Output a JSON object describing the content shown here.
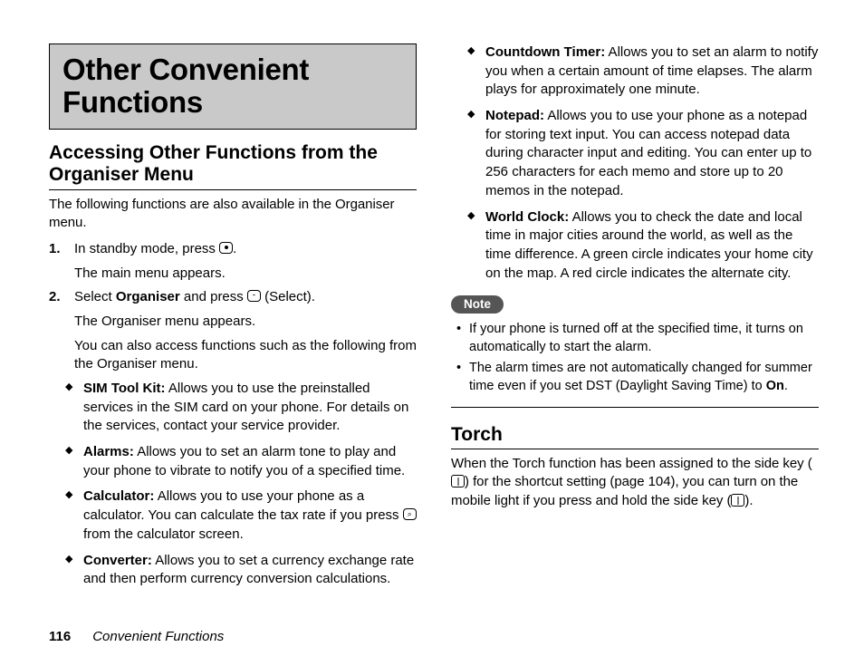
{
  "page_number": "116",
  "footer_title": "Convenient Functions",
  "chapter_title_line1": "Other Convenient",
  "chapter_title_line2": "Functions",
  "section1_title": "Accessing Other Functions from the Organiser Menu",
  "section1_intro": "The following functions are also available in the Organiser menu.",
  "steps": [
    {
      "num": "1.",
      "before": "In standby mode, press ",
      "after_key": ".",
      "result": "The main menu appears."
    },
    {
      "num": "2.",
      "before": "Select ",
      "bold": "Organiser",
      "mid": " and press ",
      "after_key": " (Select).",
      "result": "The Organiser menu appears."
    }
  ],
  "also_text": "You can also access functions such as the following from the Organiser menu.",
  "bullets_left": [
    {
      "label": "SIM Tool Kit:",
      "text": " Allows you to use the preinstalled services in the SIM card on your phone. For details on the services, contact your service provider."
    },
    {
      "label": "Alarms:",
      "text": " Allows you to set an alarm tone to play and your phone to vibrate to notify you of a specified time."
    },
    {
      "label": "Calculator:",
      "text_before": " Allows you to use your phone as a calculator. You can calculate the tax rate if you press ",
      "text_after": " from the calculator screen.",
      "has_key": true
    },
    {
      "label": "Converter:",
      "text": " Allows you to set a currency exchange rate and then perform currency conversion calculations."
    }
  ],
  "bullets_right": [
    {
      "label": "Countdown Timer:",
      "text": " Allows you to set an alarm to notify you when a certain amount of time elapses. The alarm plays for approximately one minute."
    },
    {
      "label": "Notepad:",
      "text": " Allows you to use your phone as a notepad for storing text input. You can access notepad data during character input and editing. You can enter up to 256 characters for each memo and store up to 20 memos in the notepad."
    },
    {
      "label": "World Clock:",
      "text": " Allows you to check the date and local time in major cities around the world, as well as the time difference. A green circle indicates your home city  on the map. A red circle indicates the alternate city."
    }
  ],
  "note_label": "Note",
  "notes": [
    {
      "text": "If your phone is turned off at the specified time, it turns on automatically to start the alarm."
    },
    {
      "before": "The alarm times are not automatically changed for summer time even if you set DST (Daylight Saving Time) to ",
      "bold": "On",
      "after": "."
    }
  ],
  "section2_title": "Torch",
  "torch_before": "When the Torch function has been assigned to the side key (",
  "torch_mid": ") for the shortcut setting (page 104), you can turn on the mobile light if you press and hold the side key (",
  "torch_after": ")."
}
